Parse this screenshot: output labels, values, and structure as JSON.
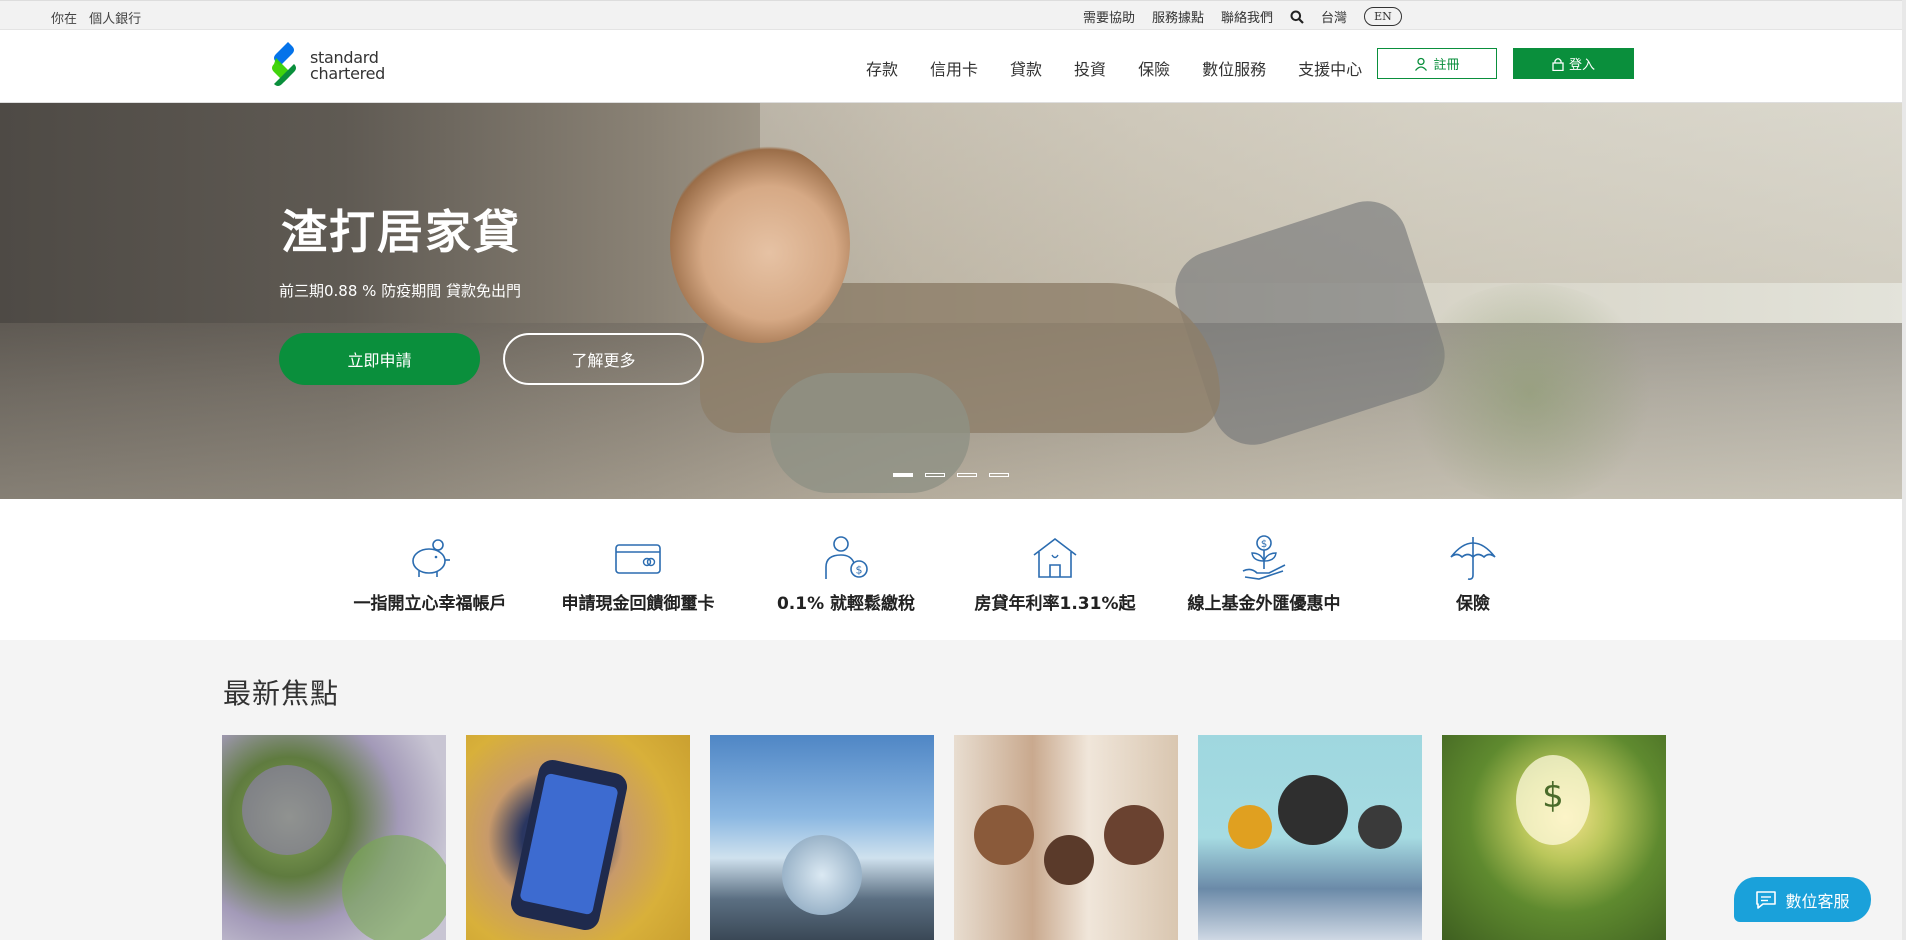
{
  "topbar": {
    "crumb_prefix": "你在",
    "crumb_current": "個人銀行",
    "links": [
      "需要協助",
      "服務據點",
      "聯絡我們"
    ],
    "region": "台灣",
    "lang_toggle": "EN"
  },
  "header": {
    "logo_line1": "standard",
    "logo_line2": "chartered",
    "nav": [
      "存款",
      "信用卡",
      "貸款",
      "投資",
      "保險",
      "數位服務",
      "支援中心"
    ],
    "register_label": "註冊",
    "login_label": "登入"
  },
  "hero": {
    "title": "渣打居家貸",
    "subtitle": "前三期0.88 % 防疫期間 貸款免出門",
    "apply_label": "立即申請",
    "more_label": "了解更多",
    "slides": 4,
    "active_slide": 1
  },
  "quick_links": [
    {
      "label": "一指開立心幸福帳戶",
      "icon": "piggy-bank-icon"
    },
    {
      "label": "申請現金回饋御璽卡",
      "icon": "credit-card-icon"
    },
    {
      "label": "0.1% 就輕鬆繳稅",
      "icon": "person-dollar-icon"
    },
    {
      "label": "房貸年利率1.31%起",
      "icon": "house-icon"
    },
    {
      "label": "線上基金外匯優惠中",
      "icon": "money-plant-icon"
    },
    {
      "label": "保險",
      "icon": "umbrella-icon"
    }
  ],
  "focus": {
    "title": "最新焦點"
  },
  "chat": {
    "label": "數位客服"
  },
  "colors": {
    "brand_green": "#0a8f3c",
    "brand_blue": "#0473ea",
    "chat_blue": "#1aa1da",
    "icon_blue": "#2b6cb0"
  }
}
